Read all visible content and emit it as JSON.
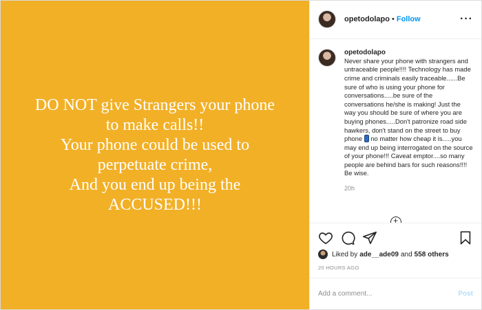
{
  "media": {
    "text": "DO NOT give Strangers your phone\nto make calls!!\nYour phone could be used to\nperpetuate crime,\nAnd you end up being the\nACCUSED!!!",
    "background_color": "#f2b027"
  },
  "header": {
    "username": "opetodolapo",
    "separator": "•",
    "follow_label": "Follow",
    "more_icon": "more-horizontal-icon"
  },
  "caption": {
    "username": "opetodolapo",
    "text_before_emoji": "Never share your phone with strangers and untraceable people!!!! Technology has made crime and criminals easily traceable......Be sure of who is using your phone for conversations.....be sure of the conversations he/she is making! Just the way you should be sure of where you are buying phones.....Don't patronize road side hawkers, don't stand on the street to buy phone ",
    "text_after_emoji": " no matter how cheap it is.....you may end up being interrogated on the source of your phone!!! Caveat emptor....so many people are behind bars for such reasons!!!! Be wise.",
    "emoji_icon": "mobile-phone-emoji-icon",
    "time": "20h"
  },
  "actions": {
    "like_icon": "heart-icon",
    "comment_icon": "comment-icon",
    "share_icon": "share-icon",
    "save_icon": "bookmark-icon"
  },
  "likes": {
    "prefix": "Liked by",
    "liker": "ade__ade09",
    "conjunction": "and",
    "others": "558 others"
  },
  "post_time": "20 HOURS AGO",
  "comment": {
    "placeholder": "Add a comment...",
    "value": "",
    "post_label": "Post"
  }
}
